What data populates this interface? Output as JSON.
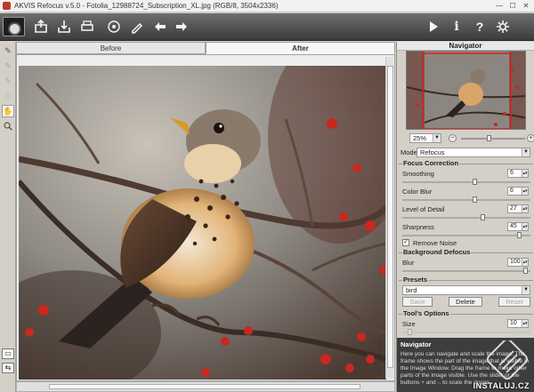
{
  "window": {
    "title": "AKVIS Refocus v.5.0 - Fotolia_12988724_Subscription_XL.jpg (RGB/8, 3504x2336)",
    "minimize": "—",
    "maximize": "☐",
    "close": "✕"
  },
  "toolbar": {
    "left_icons": [
      "app-logo-icon",
      "open-icon",
      "save-icon",
      "print-icon",
      "share-icon",
      "preferences-icon",
      "undo-icon",
      "redo-icon"
    ],
    "right_icons": [
      "run-icon",
      "info-icon",
      "help-icon",
      "settings-icon"
    ]
  },
  "tools": [
    "refocus-brush-icon",
    "eraser-icon",
    "history-brush-icon",
    "cleanup-brush-icon",
    "hand-icon",
    "zoom-icon"
  ],
  "tabs": [
    {
      "label": "Before",
      "active": false
    },
    {
      "label": "After",
      "active": true
    }
  ],
  "panel": {
    "navigator_title": "Navigator",
    "zoom_value": "25%",
    "zoom_minus": "−",
    "zoom_plus": "+",
    "zoom_level": 0.43,
    "mode_label": "Mode:",
    "mode_value": "Refocus",
    "focus_correction": {
      "title": "Focus Correction",
      "params": [
        {
          "label": "Smoothing",
          "value": "6",
          "level": 0.57
        },
        {
          "label": "Color Blur",
          "value": "6",
          "level": 0.57
        },
        {
          "label": "Level of Detail",
          "value": "27",
          "level": 0.63
        },
        {
          "label": "Sharpness",
          "value": "45",
          "level": 0.93
        }
      ],
      "remove_noise_label": "Remove Noise",
      "remove_noise_checked": true
    },
    "background_defocus": {
      "title": "Background Defocus",
      "blur_label": "Blur",
      "blur_value": "100",
      "blur_level": 0.98
    },
    "presets": {
      "title": "Presets",
      "value": "bird",
      "save_label": "Save",
      "delete_label": "Delete",
      "reset_label": "Reset"
    },
    "tools_options": {
      "title": "Tool's Options",
      "size_label": "Size",
      "size_value": "10"
    },
    "help": {
      "title": "Navigator",
      "text": "Here you can navigate and scale the image. The frame shows the part of the image that is visible in the Image Window. Drag the frame to make other parts of the image visible. Use the slider or the buttons + and -, to scale the image."
    }
  },
  "watermark": {
    "text": "INSTALUJ.CZ"
  }
}
